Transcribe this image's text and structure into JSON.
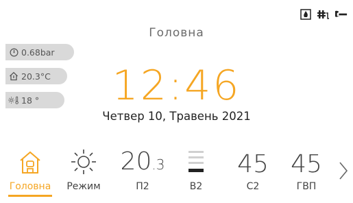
{
  "header": {
    "title": "Головна",
    "status_icons": [
      "fireplace-icon",
      "heat-pump-icon",
      "service-wrench-icon"
    ]
  },
  "sidebar": {
    "pressure": {
      "icon": "pressure-gauge-icon",
      "value": "0.68bar"
    },
    "indoor_temp": {
      "icon": "home-temperature-icon",
      "value": "20.3°C"
    },
    "outdoor_temp": {
      "icon": "outdoor-sun-thermometer-icon",
      "value": "18 °"
    }
  },
  "clock": {
    "time": "12:46",
    "date": "Четвер 10, Травень 2021"
  },
  "nav": {
    "home_label": "Головна",
    "mode_label": "Режим",
    "p2_value": "20",
    "p2_decimal": ".3",
    "p2_label": "П2",
    "b2_label": "В2",
    "c2_value": "45",
    "c2_label": "С2",
    "dhw_value": "45",
    "dhw_label": "ГВП"
  },
  "colors": {
    "accent": "#f5a623",
    "pill_bg": "#d9d9d9",
    "text": "#444444"
  }
}
